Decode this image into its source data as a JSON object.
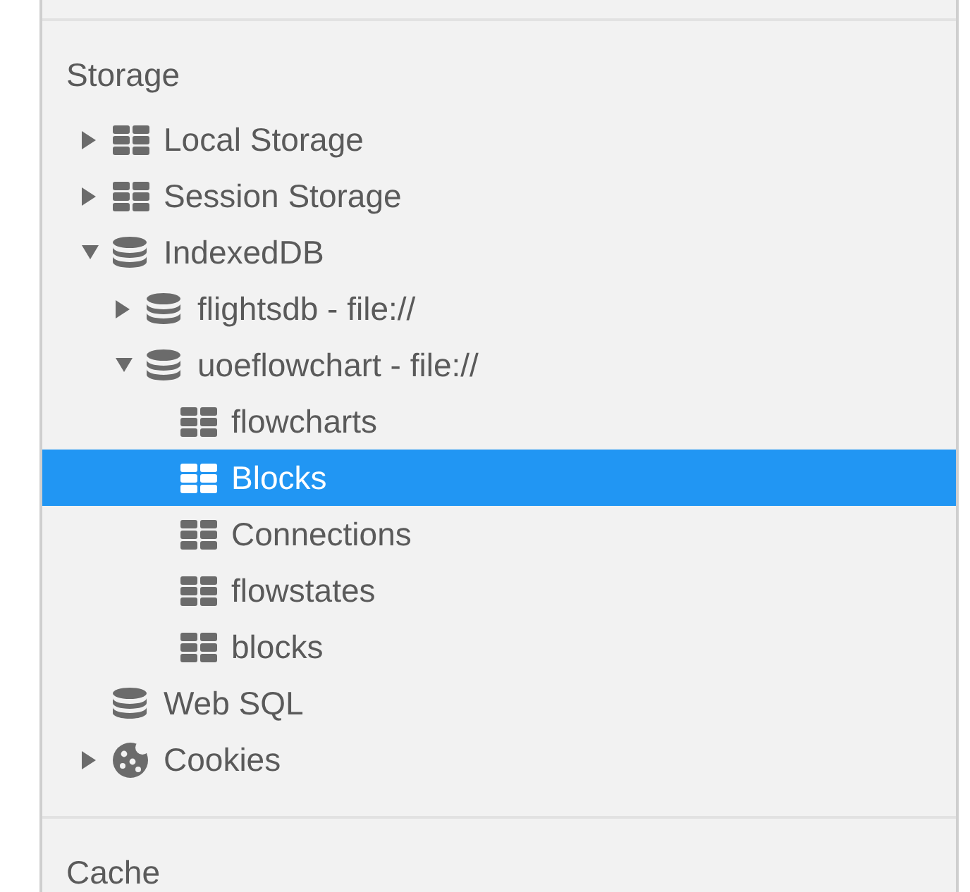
{
  "sections": [
    {
      "title": "Storage",
      "items": [
        {
          "label": "Local Storage",
          "kind": "table",
          "expanded": false,
          "selected": false
        },
        {
          "label": "Session Storage",
          "kind": "table",
          "expanded": false,
          "selected": false
        },
        {
          "label": "IndexedDB",
          "kind": "database",
          "expanded": true,
          "selected": false,
          "children": [
            {
              "label": "flightsdb - file://",
              "kind": "database",
              "expanded": false,
              "selected": false
            },
            {
              "label": "uoeflowchart - file://",
              "kind": "database",
              "expanded": true,
              "selected": false,
              "children": [
                {
                  "label": "flowcharts",
                  "kind": "table",
                  "selected": false
                },
                {
                  "label": "Blocks",
                  "kind": "table",
                  "selected": true
                },
                {
                  "label": "Connections",
                  "kind": "table",
                  "selected": false
                },
                {
                  "label": "flowstates",
                  "kind": "table",
                  "selected": false
                },
                {
                  "label": "blocks",
                  "kind": "table",
                  "selected": false
                }
              ]
            }
          ]
        },
        {
          "label": "Web SQL",
          "kind": "database",
          "selected": false
        },
        {
          "label": "Cookies",
          "kind": "cookie",
          "expanded": false,
          "selected": false
        }
      ]
    },
    {
      "title": "Cache"
    }
  ]
}
